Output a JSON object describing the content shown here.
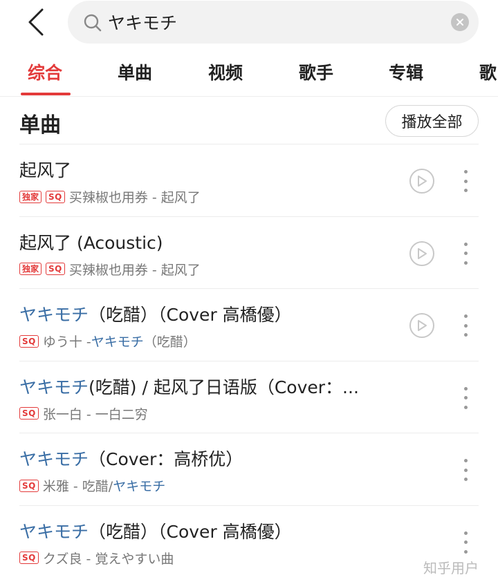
{
  "search": {
    "query": "ヤキモチ"
  },
  "tabs": [
    {
      "label": "综合",
      "active": true
    },
    {
      "label": "单曲",
      "active": false
    },
    {
      "label": "视频",
      "active": false
    },
    {
      "label": "歌手",
      "active": false
    },
    {
      "label": "专辑",
      "active": false
    },
    {
      "label": "歌",
      "active": false
    }
  ],
  "section": {
    "title": "单曲",
    "play_all_label": "播放全部"
  },
  "songs": [
    {
      "title_hl": "",
      "title_rest": "起风了",
      "tags": [
        "独家",
        "SQ"
      ],
      "artist_text": "买辣椒也用券 - 起风了",
      "has_play": true
    },
    {
      "title_hl": "",
      "title_rest": "起风了 (Acoustic)",
      "tags": [
        "独家",
        "SQ"
      ],
      "artist_text": "买辣椒也用券 - 起风了",
      "has_play": true
    },
    {
      "title_hl": "ヤキモチ",
      "title_rest": "（吃醋）（Cover 高橋優）",
      "tags": [
        "SQ"
      ],
      "artist_text": "ゆう十 - ",
      "artist_hl": "ヤキモチ",
      "artist_rest": "（吃醋）",
      "has_play": true
    },
    {
      "title_hl": "ヤキモチ",
      "title_rest": "(吃醋) / 起风了日语版（Cover：...",
      "tags": [
        "SQ"
      ],
      "artist_text": "张一白 - 一白二穷",
      "has_play": false
    },
    {
      "title_hl": "ヤキモチ",
      "title_rest": "（Cover：高桥优）",
      "tags": [
        "SQ"
      ],
      "artist_text": "米雅 - 吃醋/",
      "artist_hl": "ヤキモチ",
      "artist_rest": "",
      "has_play": false
    },
    {
      "title_hl": "ヤキモチ",
      "title_rest": "（吃醋）（Cover 高橋優）",
      "tags": [
        "SQ"
      ],
      "artist_text": "クズ良 - 覚えやすい曲",
      "has_play": false
    }
  ],
  "watermark": "知乎用户",
  "colors": {
    "accent": "#e33a3a",
    "highlight": "#3a6ea5",
    "muted": "#777777"
  }
}
